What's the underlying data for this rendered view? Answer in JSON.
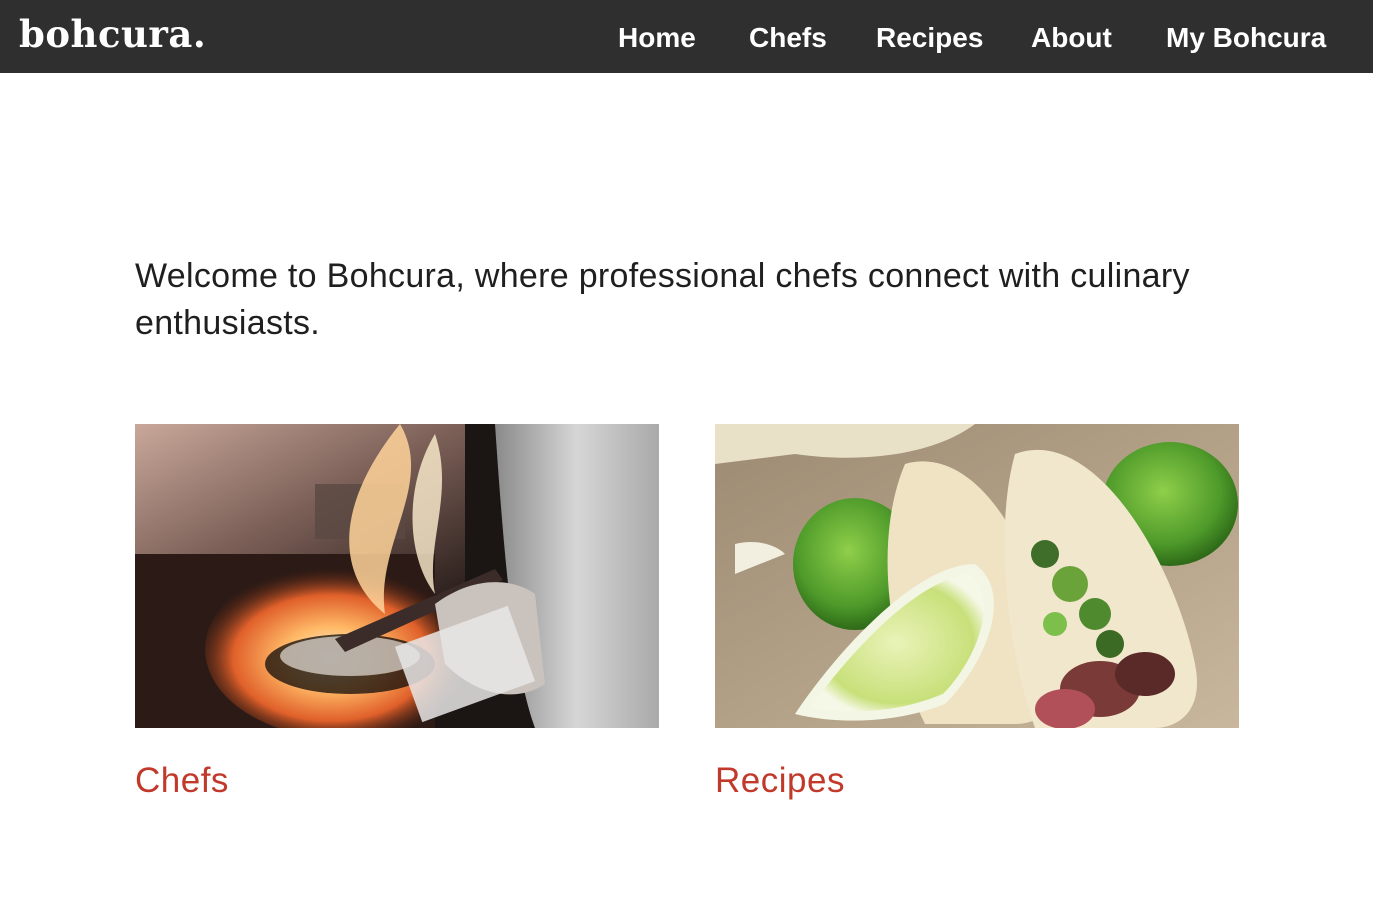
{
  "header": {
    "logo": "bohcura.",
    "nav": [
      {
        "label": "Home"
      },
      {
        "label": "Chefs"
      },
      {
        "label": "Recipes"
      },
      {
        "label": "About"
      },
      {
        "label": "My Bohcura"
      }
    ]
  },
  "main": {
    "welcome": "Welcome to Bohcura, where professional chefs connect with culinary enthusiasts.",
    "cards": [
      {
        "title": "Chefs",
        "image": "chef-flambe-photo"
      },
      {
        "title": "Recipes",
        "image": "tacos-photo"
      }
    ]
  },
  "colors": {
    "header_bg": "#2f2f2f",
    "link_red": "#c0392b",
    "text": "#1f1f1f"
  }
}
